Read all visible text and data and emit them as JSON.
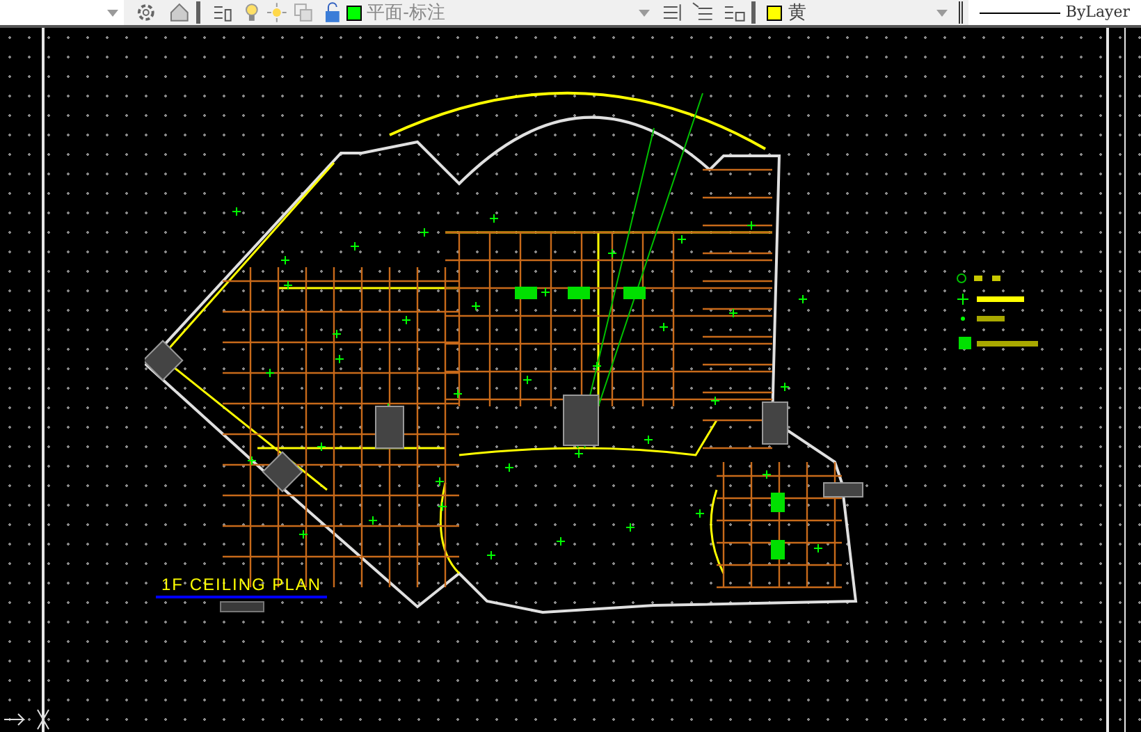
{
  "toolbar": {
    "layer": "平面-标注",
    "color_name": "黄",
    "linetype": "ByLayer"
  },
  "drawing": {
    "title": "1F CEILING PLAN"
  }
}
